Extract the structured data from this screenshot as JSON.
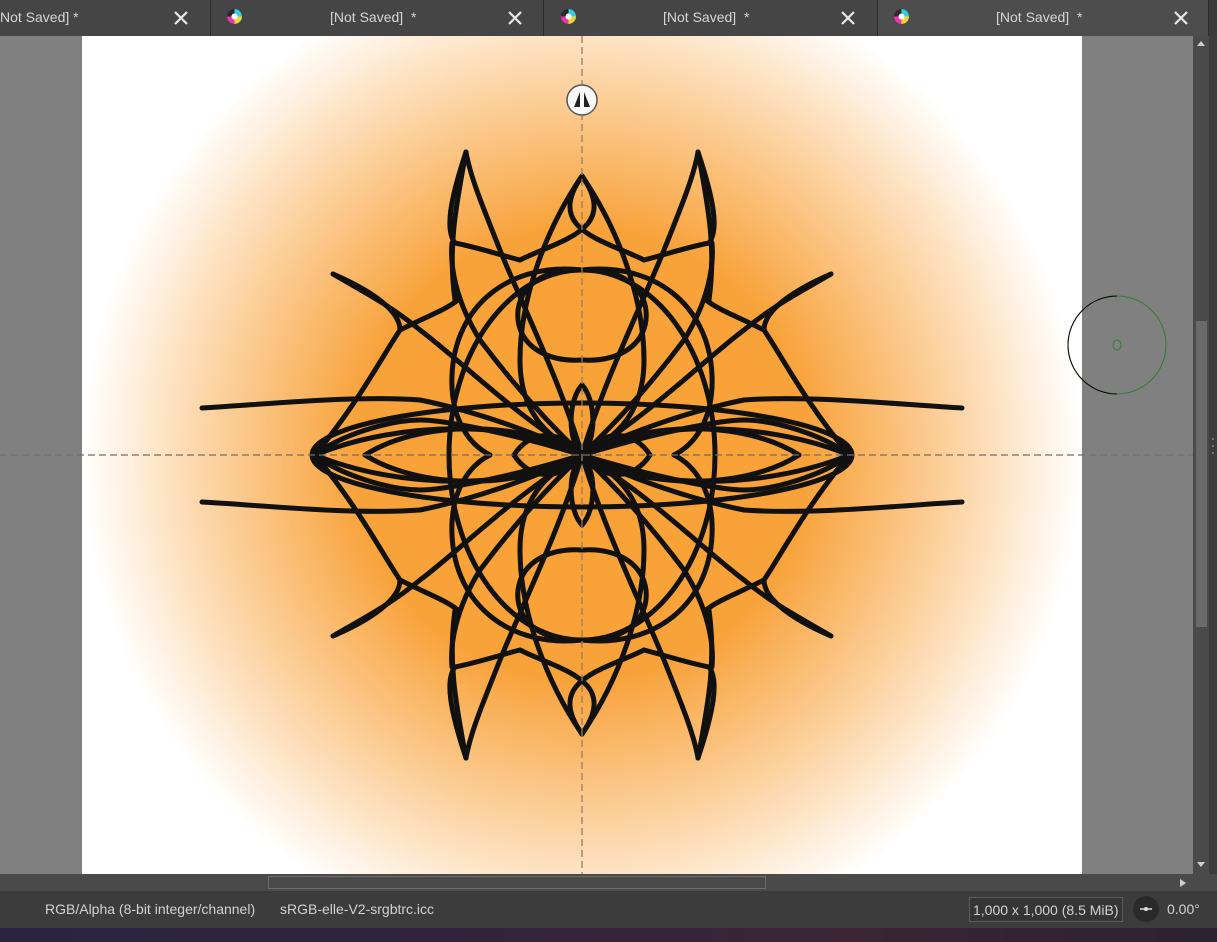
{
  "tabs": [
    {
      "title": "Not Saved]",
      "modified": "*"
    },
    {
      "title": "[Not Saved]",
      "modified": "*"
    },
    {
      "title": "[Not Saved]",
      "modified": "*"
    },
    {
      "title": "[Not Saved]",
      "modified": "*"
    }
  ],
  "statusbar": {
    "color_model": "RGB/Alpha (8-bit integer/channel)",
    "color_profile": "sRGB-elle-V2-srgbtrc.icc",
    "image_size": "1,000 x 1,000 (8.5 MiB)",
    "rotation": "0.00°"
  },
  "colors": {
    "gradient_center": "#f7a135",
    "gradient_edge": "#ffffff",
    "ink": "#111111",
    "assistant_guide": "#b08a6a",
    "tab_bg": "#454545",
    "status_bg": "#3c3c3c",
    "canvas_surround": "#808080"
  }
}
